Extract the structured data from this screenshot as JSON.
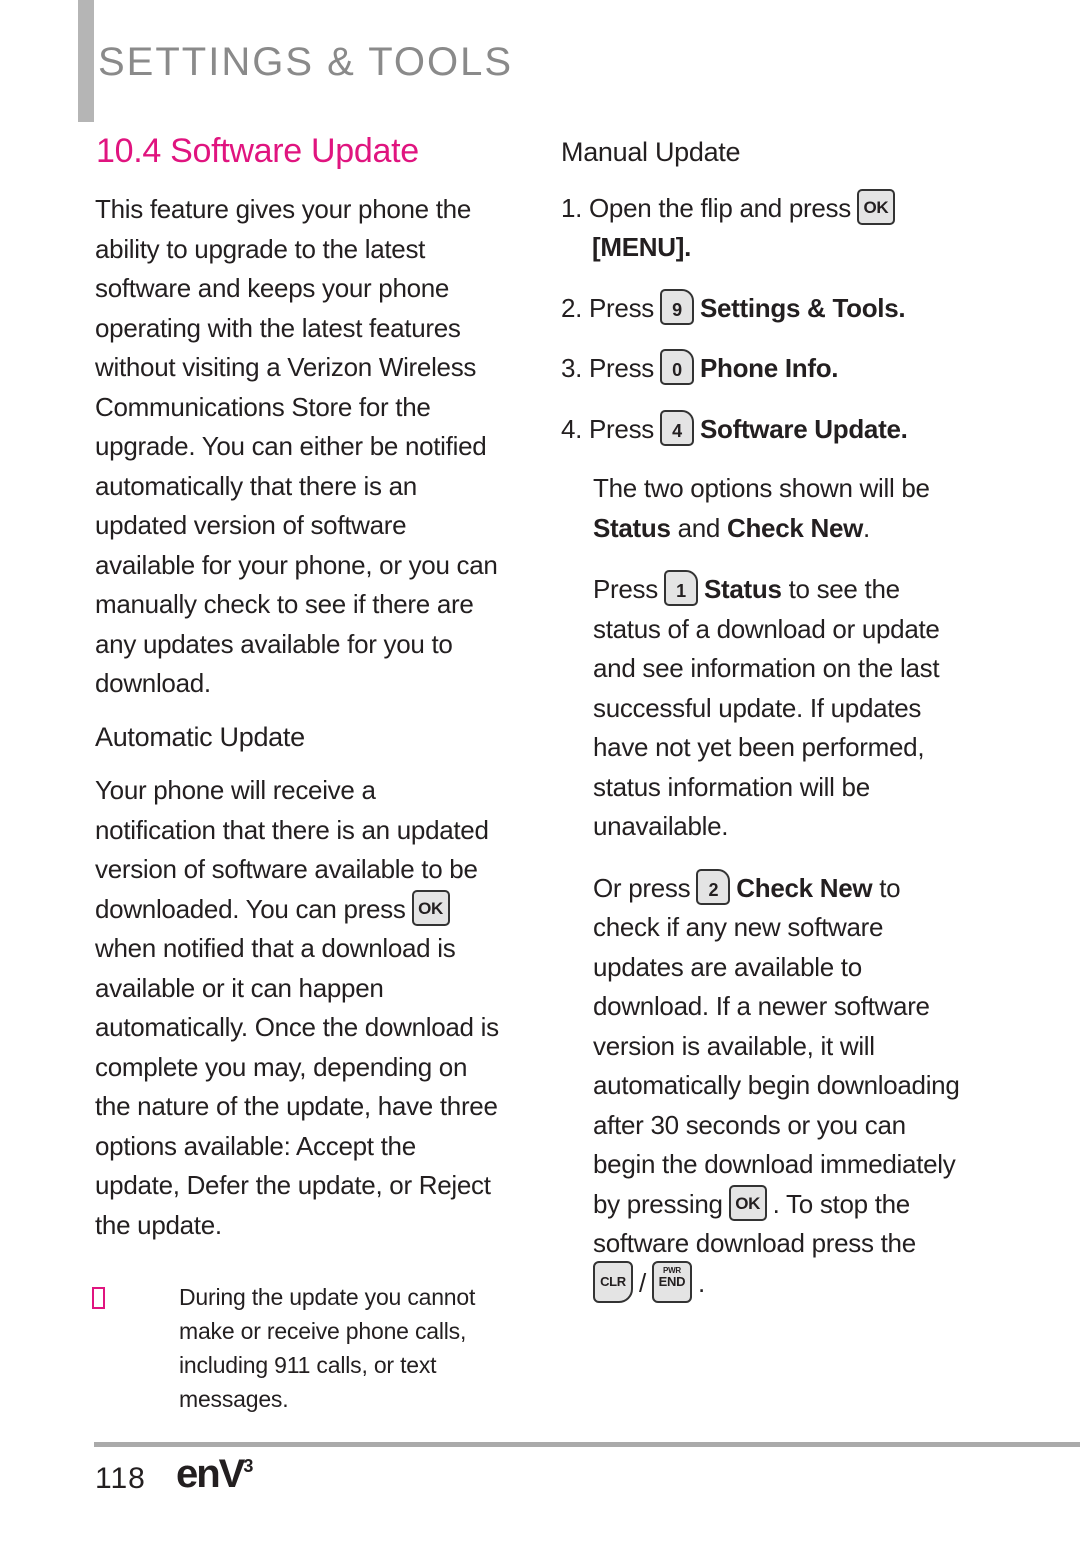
{
  "header": {
    "section": "SETTINGS & TOOLS"
  },
  "title": "10.4 Software Update",
  "intro": "This feature gives your phone the\nability to upgrade to the latest\nsoftware and keeps your phone\noperating with the latest features\nwithout visiting a Verizon Wireless\nCommunications Store for the\nupgrade. You can either be notified\nautomatically that there is an\nupdated version of software\navailable for your phone, or you can\nmanually check to see if there are\nany updates available for you to\ndownload.",
  "auto": {
    "heading": "Automatic Update",
    "p1": "Your phone will receive a\nnotification that there is an updated\nversion of software available to be",
    "p2_pre": "downloaded. You can press",
    "p3": "when notified that a download is\navailable or it can happen\nautomatically. Once the download is\ncomplete you may, depending on\nthe nature of the update, have three\noptions available: Accept the\nupdate, Defer the update, or Reject\nthe update."
  },
  "note": "During the update you cannot\nmake or receive phone calls,\nincluding 911  calls, or text\nmessages.",
  "manual": {
    "heading": "Manual Update",
    "step1_pre": "1. Open the flip and press",
    "step1_menu": "[MENU].",
    "step2_pre": "2. Press",
    "step2_target": "Settings & Tools.",
    "step3_pre": "3. Press",
    "step3_target": "Phone Info.",
    "step4_pre": "4. Press",
    "step4_target": "Software Update.",
    "options_pre": "The two options shown will be",
    "opt1": "Status",
    "and": " and ",
    "opt2": "Check New",
    "period": ".",
    "status_pre": "Press",
    "status_label": "Status",
    "status_post": " to see the",
    "status_rest": "status of a download or update\nand see information on the last\nsuccessful update. If updates\nhave not yet been performed,\nstatus information will be\nunavailable.",
    "check_pre": "Or press",
    "check_label": "Check New",
    "check_post": " to",
    "check_rest": "check if any new software\nupdates are available to\ndownload. If a newer software\nversion is available, it will\nautomatically begin downloading\nafter 30 seconds or you can\nbegin the download immediately",
    "press_pre": "by pressing",
    "press_post": ". To stop the",
    "stop_line": "software download press the",
    "slash": "/",
    "end_period": "."
  },
  "keys": {
    "ok": "OK",
    "k9": "9",
    "k0": "0",
    "k4": "4",
    "k1": "1",
    "k2": "2",
    "clr": "CLR",
    "pwr": "PWR",
    "end": "END"
  },
  "footer": {
    "page": "118",
    "logo": "enV",
    "logo_sup": "3"
  },
  "colors": {
    "accent": "#e0147f",
    "header_gray": "#8a8a8a"
  }
}
